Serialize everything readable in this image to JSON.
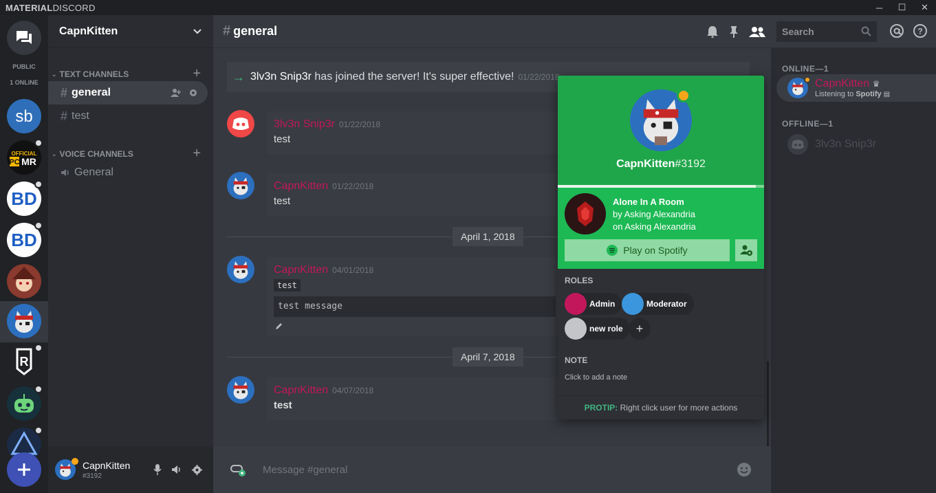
{
  "window": {
    "brand_bold": "MATERIAL",
    "brand_rest": "DISCORD"
  },
  "rail": {
    "public_label": "PUBLIC",
    "online_label": "1 ONLINE"
  },
  "guild": {
    "name": "CapnKitten"
  },
  "categories": {
    "text": "TEXT CHANNELS",
    "voice": "VOICE CHANNELS"
  },
  "text_channels": [
    {
      "name": "general",
      "active": true
    },
    {
      "name": "test",
      "active": false
    }
  ],
  "voice_channels": [
    {
      "name": "General"
    }
  ],
  "userbar": {
    "name": "CapnKitten",
    "discriminator": "#3192"
  },
  "chat": {
    "channel": "general",
    "system_message": {
      "user": "3lv3n Snip3r",
      "text": "has joined the server! It's super effective!",
      "time": "01/22/2018"
    },
    "messages": [
      {
        "author": "3lv3n Snip3r",
        "time": "01/22/2018",
        "text": "test"
      },
      {
        "author": "CapnKitten",
        "time": "01/22/2018",
        "text": "test"
      },
      {
        "author": "CapnKitten",
        "time": "04/01/2018",
        "inline_code": "test",
        "code_block": "test message"
      },
      {
        "author": "CapnKitten",
        "time": "04/07/2018",
        "text": "test"
      }
    ],
    "dividers": [
      "April 1, 2018",
      "April 7, 2018"
    ],
    "composer_placeholder": "Message #general"
  },
  "members": {
    "search_placeholder": "Search",
    "online_header": "ONLINE—1",
    "offline_header": "OFFLINE—1",
    "online": [
      {
        "name": "CapnKitten",
        "activity_prefix": "Listening to",
        "activity": "Spotify"
      }
    ],
    "offline": [
      {
        "name": "3lv3n Snip3r"
      }
    ]
  },
  "popout": {
    "name": "CapnKitten",
    "discriminator": "#3192",
    "song_title": "Alone In A Room",
    "song_artist": "by Asking Alexandria",
    "song_album": "on Asking Alexandria",
    "play_label": "Play on Spotify",
    "progress_fraction": 0.96,
    "roles_label": "ROLES",
    "roles": [
      {
        "name": "Admin",
        "color": "#c2185b"
      },
      {
        "name": "Moderator",
        "color": "#3b96dd"
      },
      {
        "name": "new role",
        "color": "#c4c5c8"
      }
    ],
    "note_label": "NOTE",
    "note_placeholder": "Click to add a note",
    "protip_label": "PROTIP:",
    "protip_text": "Right click user for more actions"
  },
  "colors": {
    "accent": "#3f51b5",
    "username": "#c2185b",
    "spotify": "#1db954",
    "idle": "#faa61a",
    "online_green": "#43b581"
  }
}
